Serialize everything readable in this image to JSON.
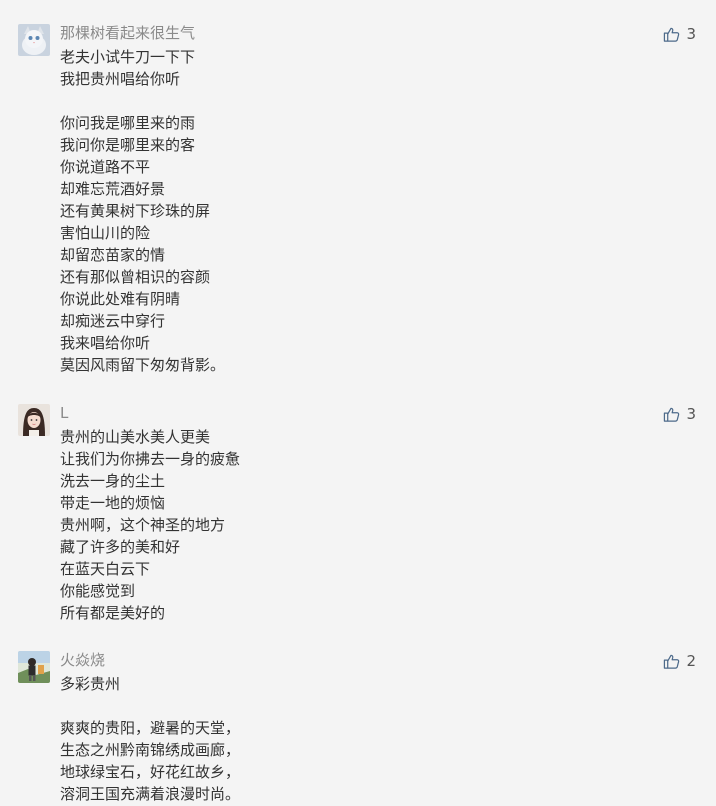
{
  "comments": [
    {
      "nickname": "那棵树看起来很生气",
      "likes": "3",
      "avatar": "cat-avatar",
      "lines": [
        "老夫小试牛刀一下下",
        "我把贵州唱给你听",
        "",
        "你问我是哪里来的雨",
        "我问你是哪里来的客",
        "你说道路不平",
        "却难忘荒酒好景",
        "还有黄果树下珍珠的屏",
        "害怕山川的险",
        "却留恋苗家的情",
        "还有那似曾相识的容颜",
        "你说此处难有阴晴",
        "却痴迷云中穿行",
        "我来唱给你听",
        "莫因风雨留下匆匆背影。"
      ]
    },
    {
      "nickname": "L",
      "likes": "3",
      "avatar": "girl-avatar",
      "lines": [
        "贵州的山美水美人更美",
        "让我们为你拂去一身的疲惫",
        "洗去一身的尘土",
        "带走一地的烦恼",
        "贵州啊，这个神圣的地方",
        "藏了许多的美和好",
        "在蓝天白云下",
        "你能感觉到",
        "所有都是美好的"
      ]
    },
    {
      "nickname": "火焱烧",
      "likes": "2",
      "avatar": "boy-avatar",
      "lines": [
        "多彩贵州",
        "",
        "爽爽的贵阳，避暑的天堂，",
        "生态之州黔南锦绣成画廊，",
        "地球绿宝石，好花红故乡，",
        "溶洞王国充满着浪漫时尚。"
      ]
    }
  ],
  "colors": {
    "background": "#f4f4f4",
    "nickname": "#8a8a8a",
    "text": "#333333"
  }
}
